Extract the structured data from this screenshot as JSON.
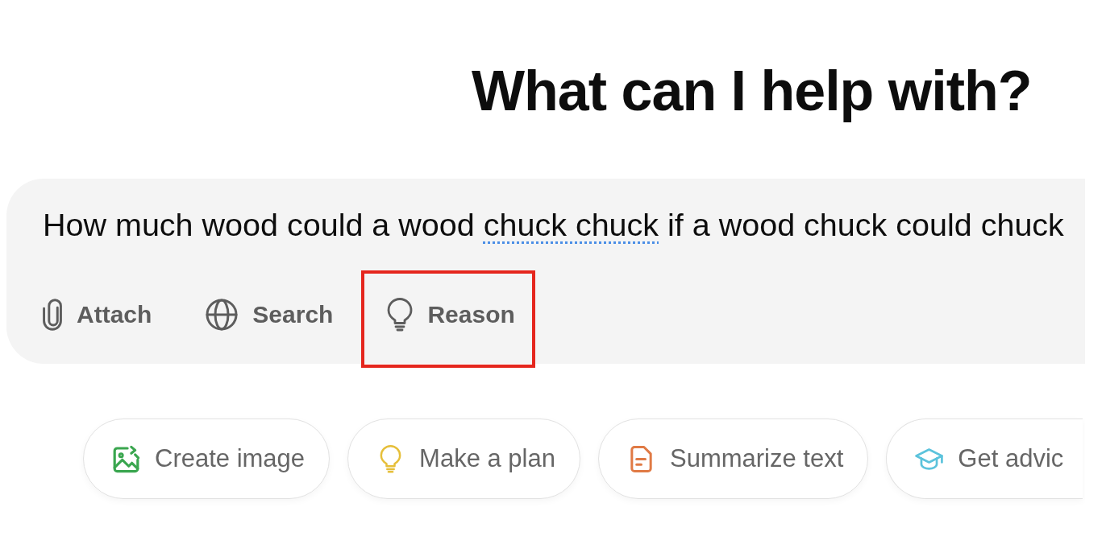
{
  "heading": "What can I help with?",
  "composer": {
    "prompt": [
      {
        "text": "How much wood could a wood ",
        "flagged": false
      },
      {
        "text": "chuck chuck",
        "flagged": true
      },
      {
        "text": " if a wood chuck could chuck",
        "flagged": false
      }
    ],
    "tools": [
      {
        "kind": "attach",
        "label": "Attach",
        "highlighted": false
      },
      {
        "kind": "search",
        "label": "Search",
        "highlighted": false
      },
      {
        "kind": "reason",
        "label": "Reason",
        "highlighted": true
      }
    ]
  },
  "suggestions": [
    {
      "kind": "image",
      "label": "Create image",
      "color": "#3aa64f"
    },
    {
      "kind": "plan",
      "label": "Make a plan",
      "color": "#e6bf3a"
    },
    {
      "kind": "summary",
      "label": "Summarize text",
      "color": "#e07a45"
    },
    {
      "kind": "advice",
      "label": "Get advic",
      "color": "#5cc3dc"
    }
  ]
}
